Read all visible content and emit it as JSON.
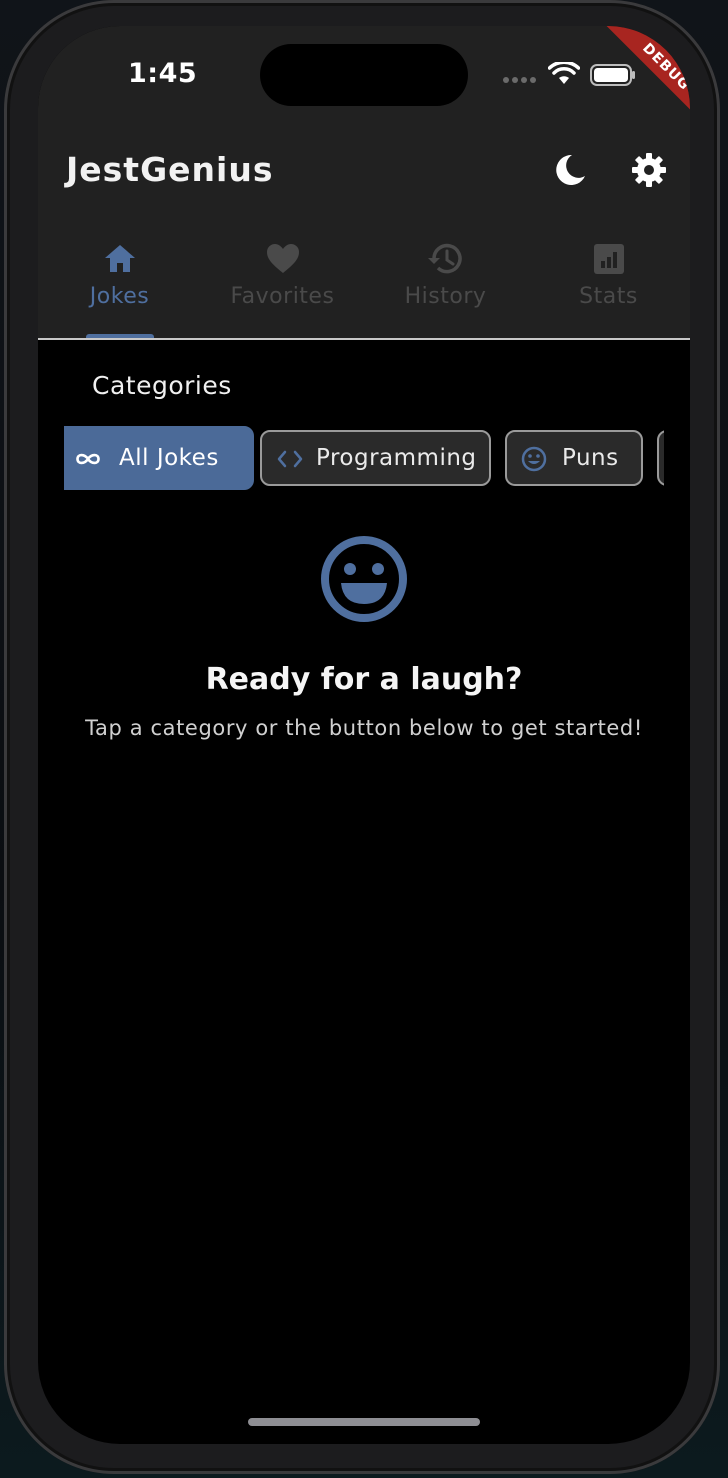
{
  "status_bar": {
    "time": "1:45",
    "debug_banner": "DEBUG"
  },
  "app_bar": {
    "title": "JestGenius",
    "theme_toggle_icon": "moon-icon",
    "settings_icon": "gear-icon"
  },
  "tabs": [
    {
      "label": "Jokes",
      "icon": "home-icon",
      "active": true
    },
    {
      "label": "Favorites",
      "icon": "heart-icon",
      "active": false
    },
    {
      "label": "History",
      "icon": "history-icon",
      "active": false
    },
    {
      "label": "Stats",
      "icon": "bar-chart-icon",
      "active": false
    }
  ],
  "categories": {
    "title": "Categories",
    "chips": [
      {
        "label": "All Jokes",
        "icon": "infinity-icon",
        "selected": true
      },
      {
        "label": "Programming",
        "icon": "code-icon",
        "selected": false
      },
      {
        "label": "Puns",
        "icon": "smiley-icon",
        "selected": false
      }
    ]
  },
  "empty_state": {
    "icon": "smiley-icon",
    "title": "Ready for a laugh?",
    "subtitle": "Tap a category or the button below to get started!"
  },
  "colors": {
    "accent": "#4f6f9f",
    "chip_selected": "#4b6a98",
    "surface": "#212121",
    "background": "#000000",
    "debug_ribbon": "#a82520"
  }
}
